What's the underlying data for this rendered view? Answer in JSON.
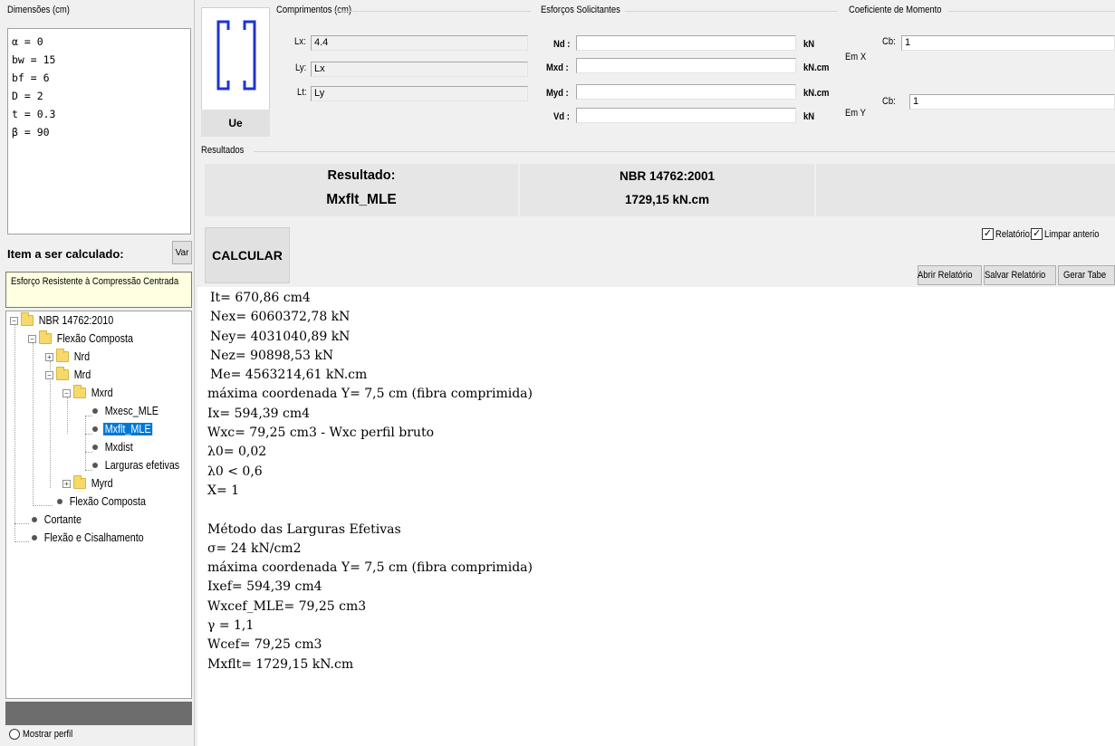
{
  "left": {
    "dimensions_caption": "Dimensões (cm)",
    "dimensions": [
      "α = 0",
      "bw = 15",
      "bf = 6",
      "D = 2",
      "t = 0.3",
      "β = 90"
    ],
    "item_title": "Item a ser calculado:",
    "var_button": "Var",
    "selected_item": "Esforço Resistente à Compressão Centrada",
    "tree": {
      "root": "NBR 14762:2010",
      "flexao_composta": "Flexão Composta",
      "nrd": "Nrd",
      "mrd": "Mrd",
      "mxrd": "Mxrd",
      "mxesc": "Mxesc_MLE",
      "mxflt": "Mxflt_MLE",
      "mxdist": "Mxdist",
      "larguras": "Larguras efetivas",
      "myrd": "Myrd",
      "flexao_composta_leaf": "Flexão Composta",
      "cortante": "Cortante",
      "flexao_cis": "Flexão e Cisalhamento"
    },
    "show_profile_label": "Mostrar perfil"
  },
  "profile": {
    "caption": "Ue"
  },
  "comprimentos": {
    "caption": "Comprimentos (cm)",
    "lx_label": "Lx:",
    "lx": "4.4",
    "ly_label": "Ly:",
    "ly": "Lx",
    "lt_label": "Lt:",
    "lt": "Ly"
  },
  "esforcos": {
    "caption": "Esforços Solicitantes",
    "nd_label": "Nd :",
    "nd": "",
    "nd_unit": "kN",
    "mxd_label": "Mxd :",
    "mxd": "",
    "mxd_unit": "kN.cm",
    "myd_label": "Myd :",
    "myd": "",
    "myd_unit": "kN.cm",
    "vd_label": "Vd :",
    "vd": "",
    "vd_unit": "kN"
  },
  "coef": {
    "caption": "Coeficiente de Momento",
    "emx_label": "Em X",
    "cbx_label": "Cb:",
    "cbx": "1",
    "emy_label": "Em Y",
    "cby_label": "Cb:",
    "cby": "1"
  },
  "resultados": {
    "caption": "Resultados",
    "result_label": "Resultado:",
    "result_name": "Mxflt_MLE",
    "norm": "NBR 14762:2001",
    "value": "1729,15 kN.cm"
  },
  "actions": {
    "calcular": "CALCULAR",
    "relatorio_label": "Relatório:",
    "limpar_label": "Limpar anterio",
    "abrir": "Abrir Relatório",
    "salvar": "Salvar Relatório",
    "gerar": "Gerar Tabe"
  },
  "report_lines": [
    "It= 670,86 cm4",
    "Nex= 6060372,78 kN",
    "Ney= 4031040,89 kN",
    "Nez= 90898,53 kN",
    "Me= 4563214,61 kN.cm",
    "máxima coordenada Y= 7,5 cm (fibra comprimida)",
    "Ix= 594,39 cm4",
    "Wxc= 79,25 cm3 - Wxc perfil bruto",
    "λ0= 0,02",
    "λ0 < 0,6",
    "X= 1",
    "",
    "Método das Larguras Efetivas",
    "σ= 24 kN/cm2",
    "máxima coordenada Y= 7,5 cm (fibra comprimida)",
    "Ixef= 594,39 cm4",
    "Wxcef_MLE= 79,25 cm3",
    "γ = 1,1",
    "Wcef= 79,25 cm3",
    "Mxflt= 1729,15 kN.cm"
  ]
}
